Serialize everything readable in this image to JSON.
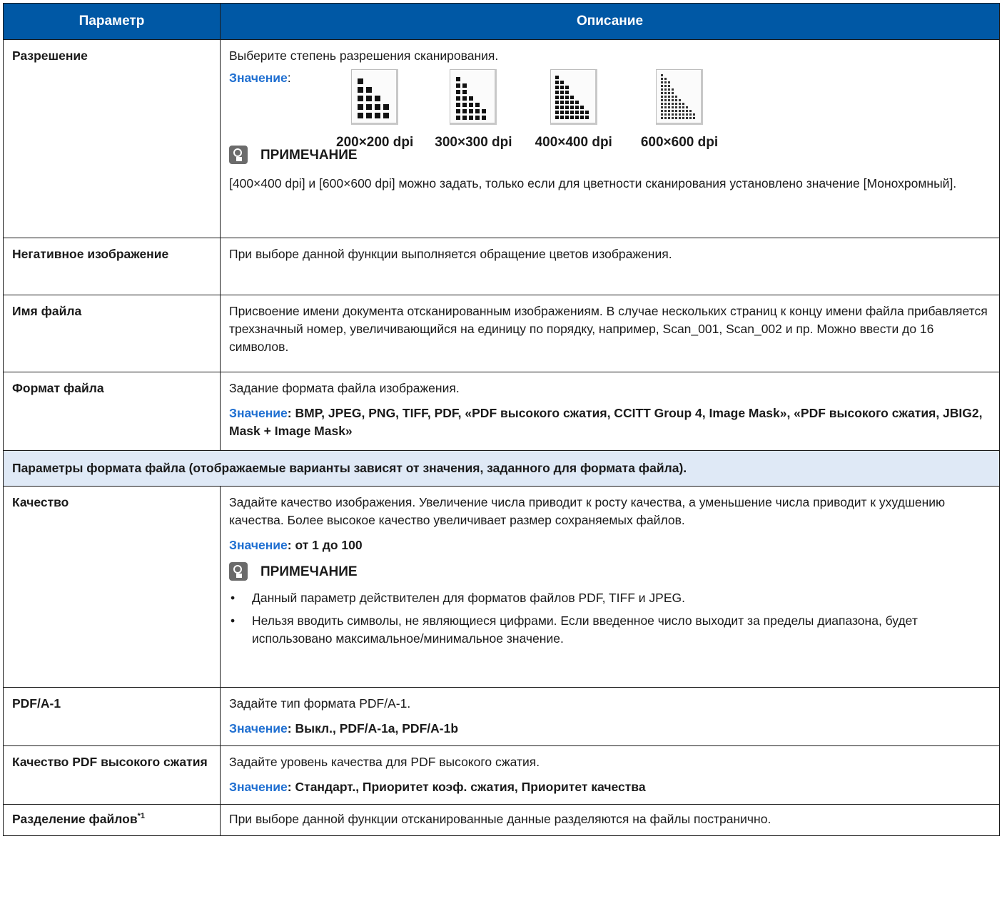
{
  "header": {
    "col1": "Параметр",
    "col2": "Описание"
  },
  "rows": {
    "resolution": {
      "name": "Разрешение",
      "desc": "Выберите степень разрешения сканирования.",
      "value_label": "Значение",
      "options": [
        "200×200 dpi",
        "300×300 dpi",
        "400×400 dpi",
        "600×600 dpi"
      ],
      "note_title": "ПРИМЕЧАНИЕ",
      "note_text": "[400×400 dpi] и [600×600 dpi] можно задать, только если для цветности сканирования установлено значение [Монохромный]."
    },
    "negative": {
      "name": "Негативное изображение",
      "desc": "При выборе данной функции выполняется обращение цветов изображения."
    },
    "filename": {
      "name": "Имя файла",
      "desc": "Присвоение имени документа отсканированным изображениям. В случае нескольких страниц к концу имени файла прибавляется трехзначный номер, увеличивающийся на единицу по порядку, например, Scan_001, Scan_002 и пр. Можно ввести до 16 символов."
    },
    "format": {
      "name": "Формат файла",
      "desc": "Задание формата файла изображения.",
      "value_label": "Значение",
      "values": ": BMP, JPEG, PNG, TIFF, PDF, «PDF высокого сжатия, CCITT Group 4, Image Mask», «PDF высокого сжатия, JBIG2, Mask + Image Mask»"
    },
    "section": {
      "text": "Параметры формата файла (отображаемые варианты зависят от значения, заданного для формата файла)."
    },
    "quality": {
      "name": "Качество",
      "desc": "Задайте качество изображения. Увеличение числа приводит к росту качества, а уменьшение числа приводит к ухудшению качества. Более высокое качество увеличивает размер сохраняемых файлов.",
      "value_label": "Значение",
      "values": ": от 1 до 100",
      "note_title": "ПРИМЕЧАНИЕ",
      "bullets": [
        "Данный параметр действителен для форматов файлов PDF, TIFF и JPEG.",
        "Нельзя вводить символы, не являющиеся цифрами. Если введенное число выходит за пределы диапазона, будет использовано максимальное/минимальное значение."
      ]
    },
    "pdfa": {
      "name": "PDF/A-1",
      "desc": "Задайте тип формата PDF/A-1.",
      "value_label": "Значение",
      "values": ": Выкл., PDF/A-1a, PDF/A-1b"
    },
    "pdfq": {
      "name": "Качество PDF высокого сжатия",
      "desc": "Задайте уровень качества для PDF высокого сжатия.",
      "value_label": "Значение",
      "values": ": Стандарт., Приоритет коэф. сжатия, Приоритет качества"
    },
    "split": {
      "name": "Разделение файлов",
      "sup": "*1",
      "desc": "При выборе данной функции отсканированные данные разделяются на файлы постранично."
    }
  }
}
